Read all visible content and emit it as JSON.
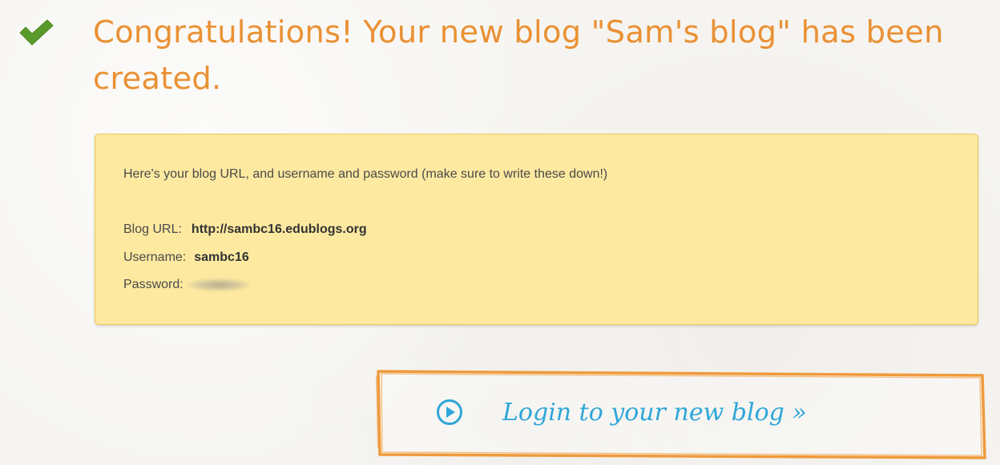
{
  "header": {
    "check_icon": "checkmark-icon",
    "title": "Congratulations! Your new blog \"Sam's blog\" has been created."
  },
  "info": {
    "intro": "Here's your blog URL, and username and password (make sure to write these down!)",
    "url_label": "Blog URL:",
    "url_value": "http://sambc16.edublogs.org",
    "username_label": "Username:",
    "username_value": "sambc16",
    "password_label": "Password:"
  },
  "login": {
    "icon": "play-circle-icon",
    "label": "Login to your new blog »"
  },
  "colors": {
    "title": "#ea9134",
    "check": "#5a9a2a",
    "box_background": "#fde9a0",
    "box_border": "#ecc55a",
    "button_frame": "#ef9a3c",
    "button_text": "#2fa6d8"
  }
}
